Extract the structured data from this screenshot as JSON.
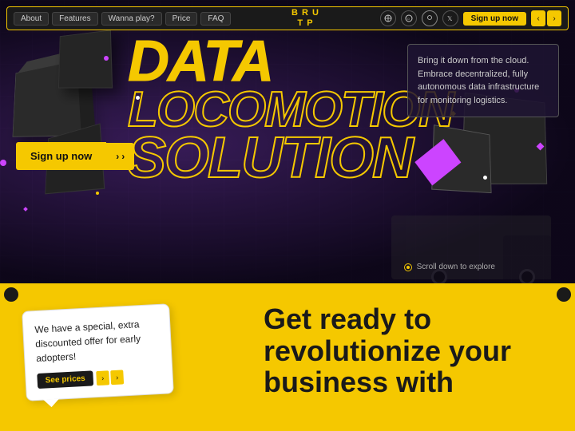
{
  "navbar": {
    "items": [
      {
        "label": "About"
      },
      {
        "label": "Features"
      },
      {
        "label": "Wanna play?"
      },
      {
        "label": "Price"
      },
      {
        "label": "FAQ"
      }
    ],
    "logo_line1": "B R U",
    "logo_line2": "T P",
    "signup_label": "Sign up now",
    "arrow_left": "‹",
    "arrow_right": "›"
  },
  "hero": {
    "title_data": "DATA",
    "title_locomotion": "LOCOMOTION",
    "title_solution": "SOLUTION.",
    "title_dot": "◆",
    "info_text": "Bring it down from the cloud. Embrace decentralized, fully autonomous data infrastructure for monitoring logistics.",
    "cta_button": "Sign up now",
    "scroll_text": "Scroll down to explore"
  },
  "yellow_section": {
    "speech_text": "We have a special, extra discounted offer for early adopters!",
    "speech_btn": "See prices",
    "main_heading_line1": "Get ready to",
    "main_heading_line2": "revolutionize your",
    "main_heading_line3": "business with"
  }
}
